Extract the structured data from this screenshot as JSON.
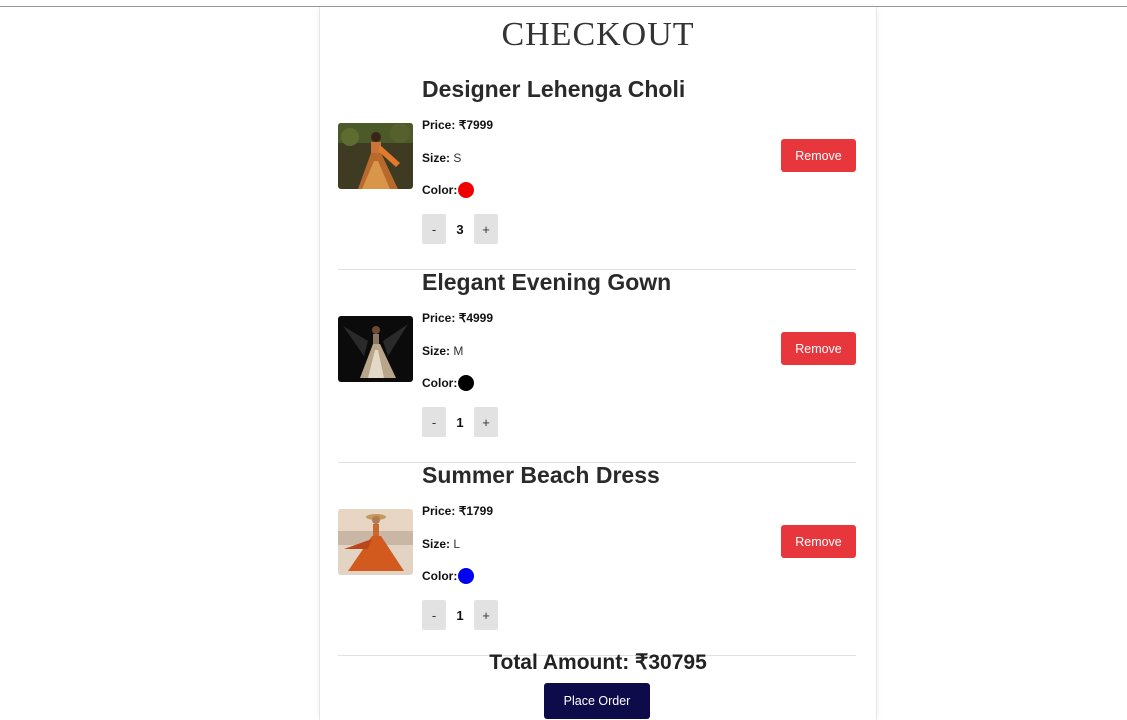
{
  "page": {
    "title": "CHECKOUT"
  },
  "labels": {
    "price": "Price:",
    "size": "Size:",
    "color": "Color:",
    "minus": "-",
    "plus": "+",
    "remove": "Remove"
  },
  "items": [
    {
      "name": "Designer Lehenga Choli",
      "price": "₹7999",
      "size": "S",
      "color": "#f00000",
      "quantity": "3",
      "image": "lehenga-photo"
    },
    {
      "name": "Elegant Evening Gown",
      "price": "₹4999",
      "size": "M",
      "color": "#000000",
      "quantity": "1",
      "image": "evening-gown-photo"
    },
    {
      "name": "Summer Beach Dress",
      "price": "₹1799",
      "size": "L",
      "color": "#0000ee",
      "quantity": "1",
      "image": "beach-dress-photo"
    }
  ],
  "summary": {
    "total_label": "Total Amount: ₹30795",
    "place_order_label": "Place Order"
  },
  "colors": {
    "remove_button": "#e8363d",
    "place_order_button": "#0e0b4a"
  }
}
